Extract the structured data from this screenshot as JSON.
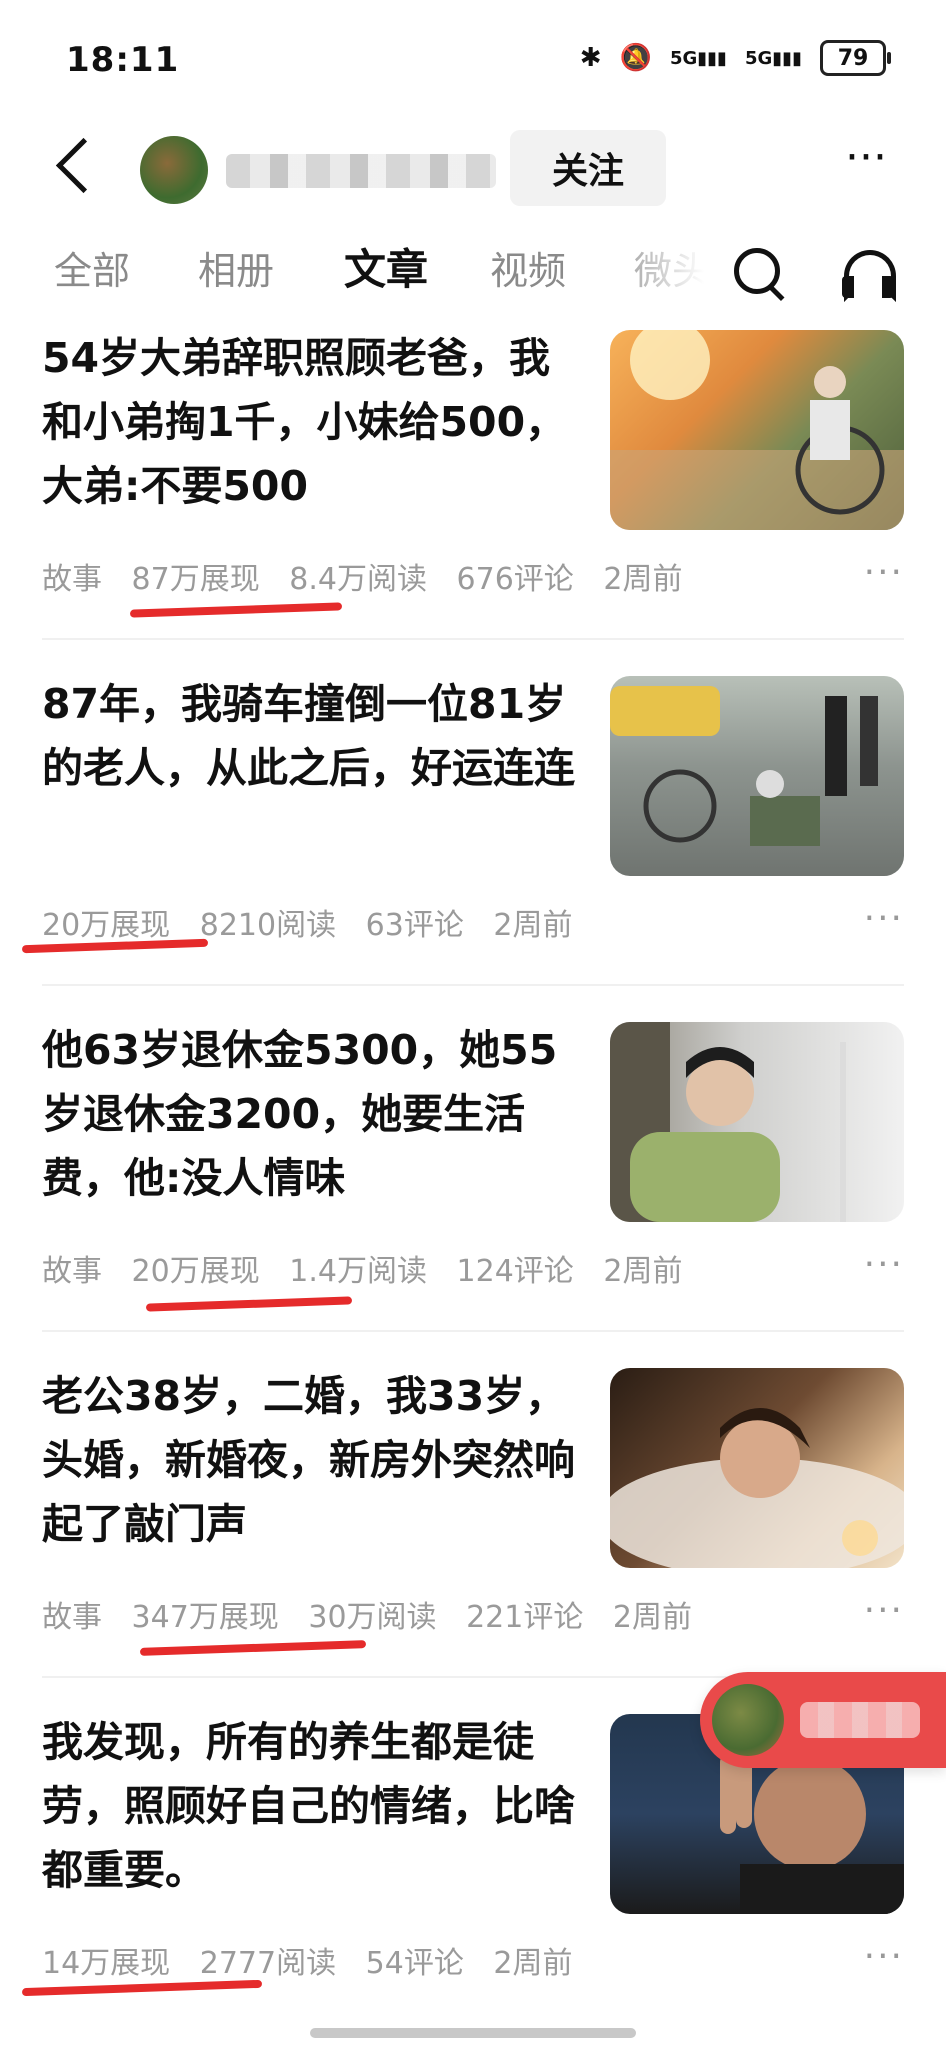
{
  "status_bar": {
    "time": "18:11",
    "battery": "79",
    "signal_1": "5G",
    "signal_2": "5G"
  },
  "header": {
    "follow_label": "关注",
    "more_label": "···"
  },
  "tabs": [
    {
      "label": "全部"
    },
    {
      "label": "相册"
    },
    {
      "label": "文章"
    },
    {
      "label": "视频"
    },
    {
      "label": "微头"
    }
  ],
  "articles": [
    {
      "title": "54岁大弟辞职照顾老爸，我和小弟掏1千，小妹给500，大弟:不要500",
      "category": "故事",
      "impressions": "87万展现",
      "reads": "8.4万阅读",
      "comments": "676评论",
      "time": "2周前",
      "more": "···"
    },
    {
      "title": "87年，我骑车撞倒一位81岁的老人，从此之后，好运连连",
      "category": "",
      "impressions": "20万展现",
      "reads": "8210阅读",
      "comments": "63评论",
      "time": "2周前",
      "more": "···"
    },
    {
      "title": "他63岁退休金5300，她55岁退休金3200，她要生活费，他:没人情味",
      "category": "故事",
      "impressions": "20万展现",
      "reads": "1.4万阅读",
      "comments": "124评论",
      "time": "2周前",
      "more": "···"
    },
    {
      "title": "老公38岁，二婚，我33岁，头婚，新婚夜，新房外突然响起了敲门声",
      "category": "故事",
      "impressions": "347万展现",
      "reads": "30万阅读",
      "comments": "221评论",
      "time": "2周前",
      "more": "···"
    },
    {
      "title": "我发现，所有的养生都是徒劳，照顾好自己的情绪，比啥都重要。",
      "category": "",
      "impressions": "14万展现",
      "reads": "2777阅读",
      "comments": "54评论",
      "time": "2周前",
      "more": "···"
    }
  ],
  "colors": {
    "accent_red": "#e52b2b",
    "meta_gray": "#9a9a9a"
  }
}
